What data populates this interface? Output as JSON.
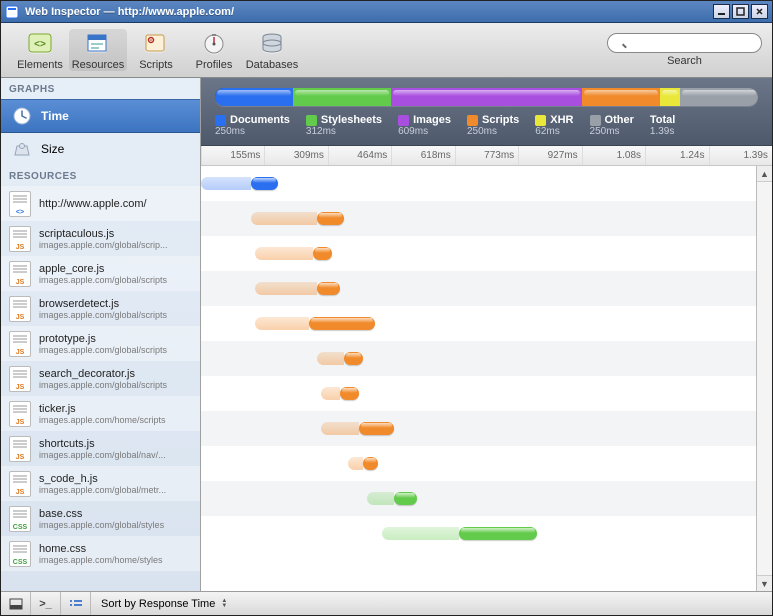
{
  "window": {
    "title": "Web Inspector — http://www.apple.com/"
  },
  "toolbar": {
    "items": [
      {
        "label": "Elements"
      },
      {
        "label": "Resources"
      },
      {
        "label": "Scripts"
      },
      {
        "label": "Profiles"
      },
      {
        "label": "Databases"
      }
    ],
    "search_label": "Search",
    "search_placeholder": ""
  },
  "sidebar": {
    "graphs_header": "GRAPHS",
    "resources_header": "RESOURCES",
    "graphs": [
      {
        "label": "Time",
        "selected": true
      },
      {
        "label": "Size",
        "selected": false
      }
    ]
  },
  "legend": [
    {
      "name": "Documents",
      "time": "250ms",
      "color": "#2a6ff0"
    },
    {
      "name": "Stylesheets",
      "time": "312ms",
      "color": "#63cb4b"
    },
    {
      "name": "Images",
      "time": "609ms",
      "color": "#a94fe0"
    },
    {
      "name": "Scripts",
      "time": "250ms",
      "color": "#f08a2a"
    },
    {
      "name": "XHR",
      "time": "62ms",
      "color": "#e9e83a"
    },
    {
      "name": "Other",
      "time": "250ms",
      "color": "#9aa0a8"
    },
    {
      "name": "Total",
      "time": "1.39s",
      "color": null
    }
  ],
  "ruler": [
    "155ms",
    "309ms",
    "464ms",
    "618ms",
    "773ms",
    "927ms",
    "1.08s",
    "1.24s",
    "1.39s"
  ],
  "resources": [
    {
      "name": "http://www.apple.com/",
      "path": "",
      "type": "doc",
      "start": 0,
      "latency": 26,
      "load": 14
    },
    {
      "name": "scriptaculous.js",
      "path": "images.apple.com/global/scrip...",
      "type": "js",
      "start": 26,
      "latency": 34,
      "load": 14
    },
    {
      "name": "apple_core.js",
      "path": "images.apple.com/global/scripts",
      "type": "js",
      "start": 28,
      "latency": 30,
      "load": 10
    },
    {
      "name": "browserdetect.js",
      "path": "images.apple.com/global/scripts",
      "type": "js",
      "start": 28,
      "latency": 32,
      "load": 12
    },
    {
      "name": "prototype.js",
      "path": "images.apple.com/global/scripts",
      "type": "js",
      "start": 28,
      "latency": 28,
      "load": 34
    },
    {
      "name": "search_decorator.js",
      "path": "images.apple.com/global/scripts",
      "type": "js",
      "start": 60,
      "latency": 14,
      "load": 10
    },
    {
      "name": "ticker.js",
      "path": "images.apple.com/home/scripts",
      "type": "js",
      "start": 62,
      "latency": 10,
      "load": 10
    },
    {
      "name": "shortcuts.js",
      "path": "images.apple.com/global/nav/...",
      "type": "js",
      "start": 62,
      "latency": 20,
      "load": 18
    },
    {
      "name": "s_code_h.js",
      "path": "images.apple.com/global/metr...",
      "type": "js",
      "start": 76,
      "latency": 8,
      "load": 8
    },
    {
      "name": "base.css",
      "path": "images.apple.com/global/styles",
      "type": "css",
      "start": 86,
      "latency": 14,
      "load": 12
    },
    {
      "name": "home.css",
      "path": "images.apple.com/home/styles",
      "type": "css",
      "start": 94,
      "latency": 40,
      "load": 40
    }
  ],
  "statusbar": {
    "sort_label": "Sort by Response Time"
  },
  "chart_data": {
    "type": "bar",
    "title": "Resource load breakdown by type",
    "categories": [
      "Documents",
      "Stylesheets",
      "Images",
      "Scripts",
      "XHR",
      "Other"
    ],
    "values_ms": [
      250,
      312,
      609,
      250,
      62,
      250
    ],
    "total_ms": 1390,
    "xlabel": "",
    "ylabel": "Time"
  }
}
